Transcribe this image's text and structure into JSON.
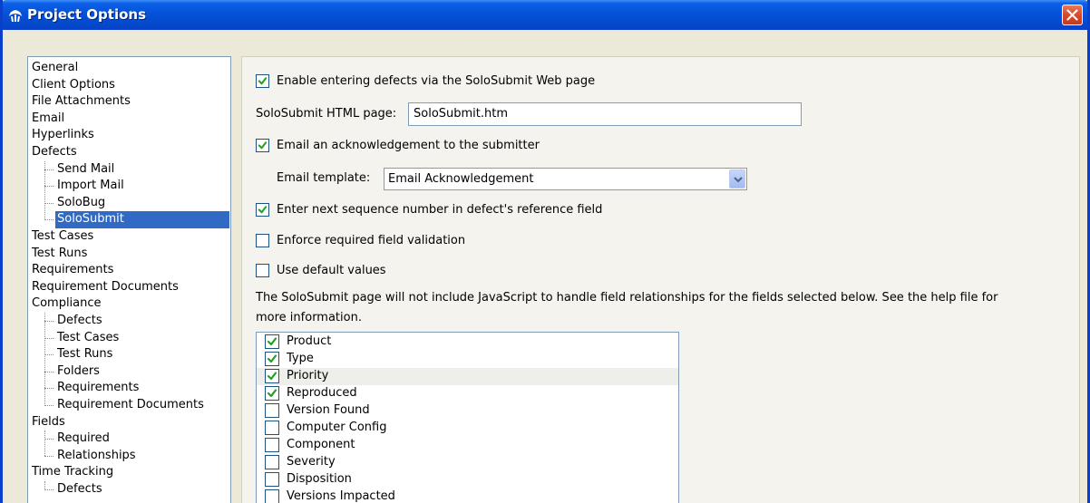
{
  "window": {
    "title": "Project Options"
  },
  "sidebar": {
    "items": [
      {
        "label": "General",
        "level": 0
      },
      {
        "label": "Client Options",
        "level": 0
      },
      {
        "label": "File Attachments",
        "level": 0
      },
      {
        "label": "Email",
        "level": 0
      },
      {
        "label": "Hyperlinks",
        "level": 0
      },
      {
        "label": "Defects",
        "level": 0
      },
      {
        "label": "Send Mail",
        "level": 1
      },
      {
        "label": "Import Mail",
        "level": 1
      },
      {
        "label": "SoloBug",
        "level": 1
      },
      {
        "label": "SoloSubmit",
        "level": 1,
        "selected": true
      },
      {
        "label": "Test Cases",
        "level": 0
      },
      {
        "label": "Test Runs",
        "level": 0
      },
      {
        "label": "Requirements",
        "level": 0
      },
      {
        "label": "Requirement Documents",
        "level": 0
      },
      {
        "label": "Compliance",
        "level": 0
      },
      {
        "label": "Defects",
        "level": 1
      },
      {
        "label": "Test Cases",
        "level": 1
      },
      {
        "label": "Test Runs",
        "level": 1
      },
      {
        "label": "Folders",
        "level": 1
      },
      {
        "label": "Requirements",
        "level": 1
      },
      {
        "label": "Requirement Documents",
        "level": 1
      },
      {
        "label": "Fields",
        "level": 0
      },
      {
        "label": "Required",
        "level": 1
      },
      {
        "label": "Relationships",
        "level": 1
      },
      {
        "label": "Time Tracking",
        "level": 0
      },
      {
        "label": "Defects",
        "level": 1
      }
    ]
  },
  "options": {
    "enable_websubmit": {
      "label": "Enable entering defects via the SoloSubmit Web page",
      "checked": true
    },
    "html_page_label": "SoloSubmit HTML page:",
    "html_page_value": "SoloSubmit.htm",
    "email_ack": {
      "label": "Email an acknowledgement to the submitter",
      "checked": true
    },
    "email_template_label": "Email template:",
    "email_template_value": "Email Acknowledgement",
    "sequence_number": {
      "label": "Enter next sequence number in defect's reference field",
      "checked": true
    },
    "required_validation": {
      "label": "Enforce required field validation",
      "checked": false
    },
    "default_values": {
      "label": "Use default values",
      "checked": false
    },
    "info_line1": "The SoloSubmit page will not include JavaScript to handle field relationships for the fields selected below.  See the help file for",
    "info_line2": "more information."
  },
  "fields": [
    {
      "label": "Product",
      "checked": true
    },
    {
      "label": "Type",
      "checked": true
    },
    {
      "label": "Priority",
      "checked": true,
      "highlighted": true
    },
    {
      "label": "Reproduced",
      "checked": true
    },
    {
      "label": "Version Found",
      "checked": false
    },
    {
      "label": "Computer Config",
      "checked": false
    },
    {
      "label": "Component",
      "checked": false
    },
    {
      "label": "Severity",
      "checked": false
    },
    {
      "label": "Disposition",
      "checked": false
    },
    {
      "label": "Versions Impacted",
      "checked": false
    }
  ],
  "colors": {
    "titlebar": "#0550d8",
    "selection": "#316ac5",
    "checkmark": "#21a121",
    "close_button": "#d6492b"
  }
}
